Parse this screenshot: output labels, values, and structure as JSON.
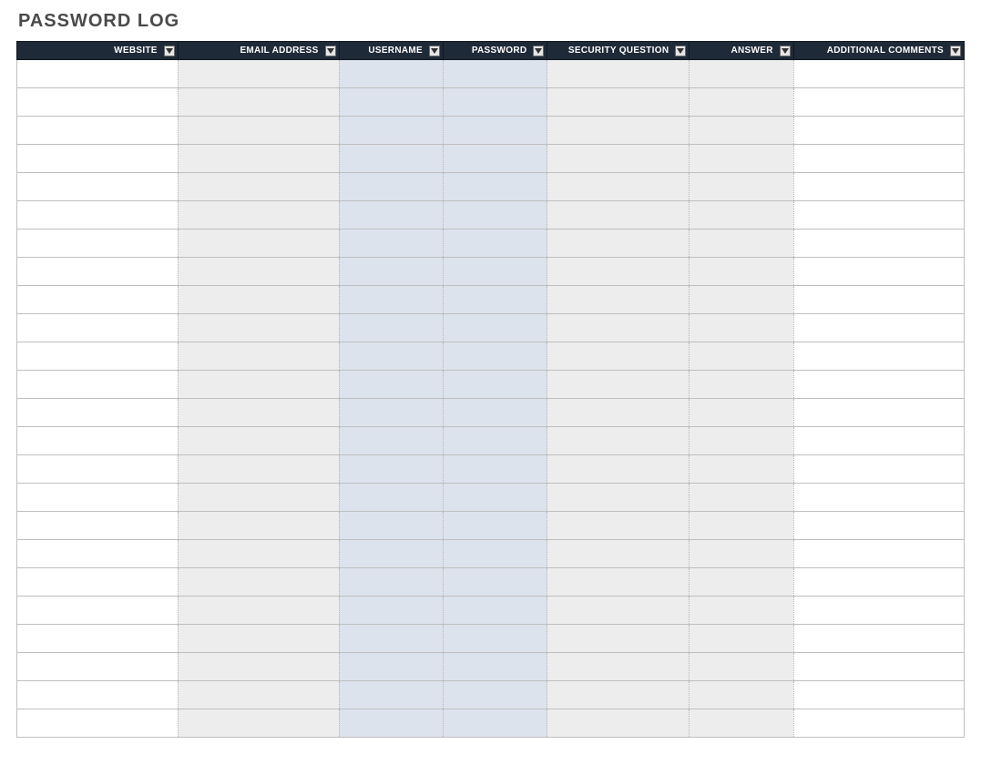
{
  "title": "PASSWORD LOG",
  "columns": [
    {
      "key": "website",
      "label": "WEBSITE"
    },
    {
      "key": "email",
      "label": "EMAIL ADDRESS"
    },
    {
      "key": "username",
      "label": "USERNAME"
    },
    {
      "key": "password",
      "label": "PASSWORD"
    },
    {
      "key": "secq",
      "label": "SECURITY QUESTION"
    },
    {
      "key": "answer",
      "label": "ANSWER"
    },
    {
      "key": "comments",
      "label": "ADDITIONAL COMMENTS"
    }
  ],
  "rows": [
    {
      "website": "",
      "email": "",
      "username": "",
      "password": "",
      "secq": "",
      "answer": "",
      "comments": ""
    },
    {
      "website": "",
      "email": "",
      "username": "",
      "password": "",
      "secq": "",
      "answer": "",
      "comments": ""
    },
    {
      "website": "",
      "email": "",
      "username": "",
      "password": "",
      "secq": "",
      "answer": "",
      "comments": ""
    },
    {
      "website": "",
      "email": "",
      "username": "",
      "password": "",
      "secq": "",
      "answer": "",
      "comments": ""
    },
    {
      "website": "",
      "email": "",
      "username": "",
      "password": "",
      "secq": "",
      "answer": "",
      "comments": ""
    },
    {
      "website": "",
      "email": "",
      "username": "",
      "password": "",
      "secq": "",
      "answer": "",
      "comments": ""
    },
    {
      "website": "",
      "email": "",
      "username": "",
      "password": "",
      "secq": "",
      "answer": "",
      "comments": ""
    },
    {
      "website": "",
      "email": "",
      "username": "",
      "password": "",
      "secq": "",
      "answer": "",
      "comments": ""
    },
    {
      "website": "",
      "email": "",
      "username": "",
      "password": "",
      "secq": "",
      "answer": "",
      "comments": ""
    },
    {
      "website": "",
      "email": "",
      "username": "",
      "password": "",
      "secq": "",
      "answer": "",
      "comments": ""
    },
    {
      "website": "",
      "email": "",
      "username": "",
      "password": "",
      "secq": "",
      "answer": "",
      "comments": ""
    },
    {
      "website": "",
      "email": "",
      "username": "",
      "password": "",
      "secq": "",
      "answer": "",
      "comments": ""
    },
    {
      "website": "",
      "email": "",
      "username": "",
      "password": "",
      "secq": "",
      "answer": "",
      "comments": ""
    },
    {
      "website": "",
      "email": "",
      "username": "",
      "password": "",
      "secq": "",
      "answer": "",
      "comments": ""
    },
    {
      "website": "",
      "email": "",
      "username": "",
      "password": "",
      "secq": "",
      "answer": "",
      "comments": ""
    },
    {
      "website": "",
      "email": "",
      "username": "",
      "password": "",
      "secq": "",
      "answer": "",
      "comments": ""
    },
    {
      "website": "",
      "email": "",
      "username": "",
      "password": "",
      "secq": "",
      "answer": "",
      "comments": ""
    },
    {
      "website": "",
      "email": "",
      "username": "",
      "password": "",
      "secq": "",
      "answer": "",
      "comments": ""
    },
    {
      "website": "",
      "email": "",
      "username": "",
      "password": "",
      "secq": "",
      "answer": "",
      "comments": ""
    },
    {
      "website": "",
      "email": "",
      "username": "",
      "password": "",
      "secq": "",
      "answer": "",
      "comments": ""
    },
    {
      "website": "",
      "email": "",
      "username": "",
      "password": "",
      "secq": "",
      "answer": "",
      "comments": ""
    },
    {
      "website": "",
      "email": "",
      "username": "",
      "password": "",
      "secq": "",
      "answer": "",
      "comments": ""
    },
    {
      "website": "",
      "email": "",
      "username": "",
      "password": "",
      "secq": "",
      "answer": "",
      "comments": ""
    },
    {
      "website": "",
      "email": "",
      "username": "",
      "password": "",
      "secq": "",
      "answer": "",
      "comments": ""
    }
  ]
}
